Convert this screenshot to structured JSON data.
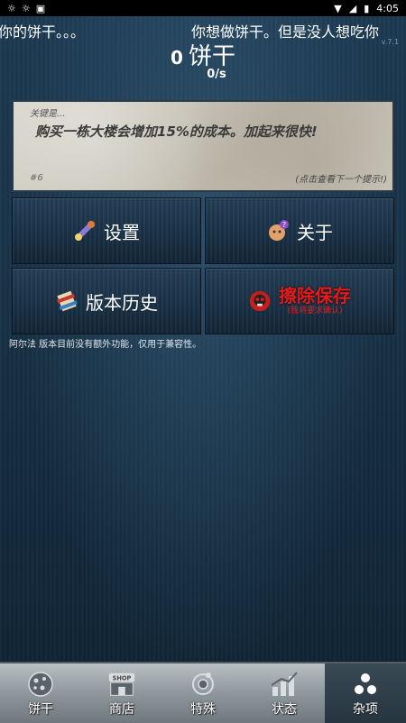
{
  "status_bar": {
    "time": "4:05"
  },
  "ticker": {
    "left_text": "你的饼干。。。",
    "right_text": "你想做饼干。但是没人想吃你"
  },
  "version": "v.7.1",
  "counter": {
    "value": "0",
    "unit": "饼干",
    "rate": "0/s"
  },
  "tip": {
    "label": "关键是...",
    "text": "购买一栋大楼会增加15%的成本。加起来很快!",
    "number": "#6",
    "next_hint": "(点击查看下一个提示!)"
  },
  "buttons": {
    "settings": "设置",
    "about": "关于",
    "history": "版本历史",
    "erase": "擦除保存",
    "erase_sub": "(我将要求确认)"
  },
  "note": "阿尔法 版本目前没有额外功能，仅用于兼容性。",
  "tabs": [
    {
      "label": "饼干",
      "icon": "cookie-icon"
    },
    {
      "label": "商店",
      "icon": "shop-icon"
    },
    {
      "label": "特殊",
      "icon": "special-icon"
    },
    {
      "label": "状态",
      "icon": "stats-icon"
    },
    {
      "label": "杂项",
      "icon": "misc-icon"
    }
  ],
  "active_tab": "杂项"
}
